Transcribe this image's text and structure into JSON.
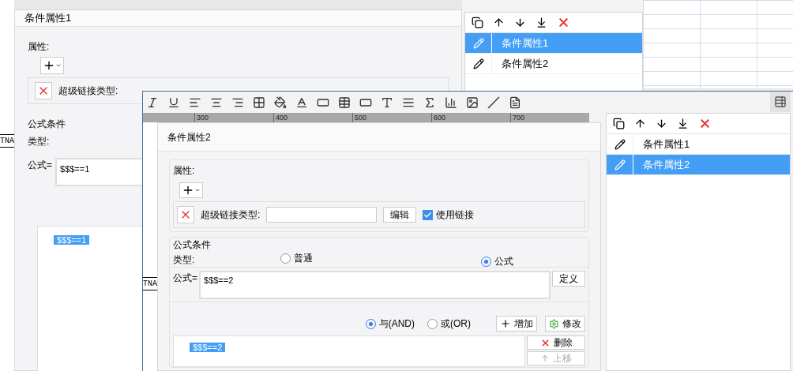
{
  "back": {
    "sheet_cells": [
      "TNA"
    ],
    "dialog": {
      "title": "条件属性1",
      "properties_label": "属性:",
      "hyperlink_label": "超级链接类型:",
      "formula_section": "公式条件",
      "type_label": "类型:",
      "formula_label": "公式=",
      "formula_value": "$$$==1",
      "conditions": [
        {
          "text": "$$$==1",
          "selected": true
        }
      ]
    },
    "list": {
      "items": [
        {
          "label": "条件属性1",
          "selected": true
        },
        {
          "label": "条件属性2",
          "selected": false
        }
      ]
    }
  },
  "front": {
    "sheet_cells": [
      "TNA"
    ],
    "ruler": [
      "300",
      "400",
      "500",
      "600",
      "700"
    ],
    "dialog": {
      "title": "条件属性2",
      "properties_label": "属性:",
      "hyperlink_label": "超级链接类型:",
      "edit_button": "编辑",
      "use_link": {
        "label": "使用链接",
        "checked": true
      },
      "formula_section": "公式条件",
      "type_label": "类型:",
      "types": [
        {
          "label": "普通",
          "selected": false
        },
        {
          "label": "公式",
          "selected": true
        }
      ],
      "formula_label": "公式=",
      "formula_value": "$$$==2",
      "define_button": "定义",
      "logic": [
        {
          "label": "与(AND)",
          "selected": true
        },
        {
          "label": "或(OR)",
          "selected": false
        }
      ],
      "add_button": "增加",
      "modify_button": "修改",
      "conditions": [
        {
          "text": "$$$==2",
          "selected": true
        }
      ],
      "side_buttons": [
        {
          "label": "删除",
          "kind": "delete",
          "disabled": false
        },
        {
          "label": "上移",
          "kind": "up",
          "disabled": true
        }
      ]
    },
    "list": {
      "items": [
        {
          "label": "条件属性1",
          "selected": false
        },
        {
          "label": "条件属性2",
          "selected": true
        }
      ]
    }
  }
}
